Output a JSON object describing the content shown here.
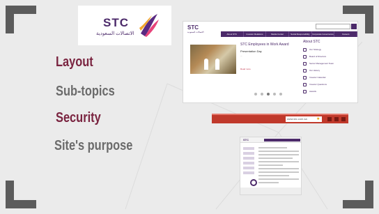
{
  "logo": {
    "brand": "STC",
    "arabic": "الاتصالات السعودية"
  },
  "topics": [
    "Layout",
    "Sub-topics",
    "Security",
    "Site's purpose"
  ],
  "site": {
    "logo": "STC",
    "logo_sub": "الاتصالات السعودية",
    "nav": [
      "About STC",
      "Investor Relations",
      "Media Center",
      "Social Responsibility",
      "Corporate Governance",
      "Careers"
    ],
    "hero_title": "STC Employees in Work Award",
    "hero_subtitle": "Presentation Day",
    "hero_body": "...",
    "hero_more": "Read more",
    "about_title": "About STC",
    "about_items": [
      "Our Strategy",
      "Board of Directors",
      "Senior Management Team",
      "Our History",
      "Investor Calendar",
      "Investor Questions",
      "Awards"
    ]
  },
  "browser": {
    "address": "www.stc.com.sa"
  },
  "colors": {
    "accent": "#7a2440",
    "brand_purple": "#4c2a6a",
    "muted": "#6b6b6b",
    "bar_red": "#c0392b"
  }
}
